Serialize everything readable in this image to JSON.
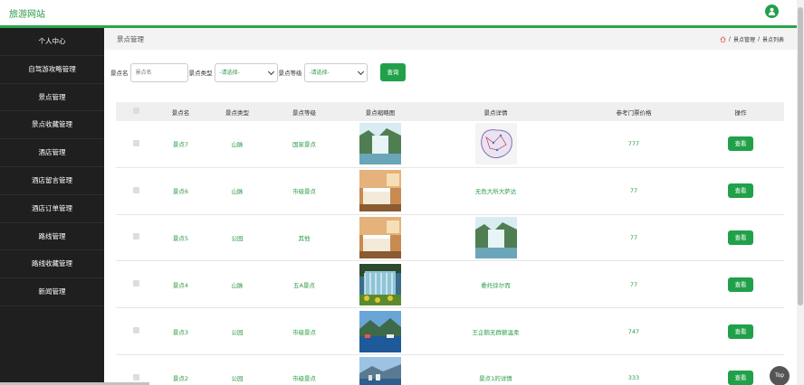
{
  "header": {
    "brand": "旅游网站"
  },
  "sidebar": {
    "items": [
      {
        "label": "个人中心"
      },
      {
        "label": "自驾游攻略管理"
      },
      {
        "label": "景点管理"
      },
      {
        "label": "景点收藏管理"
      },
      {
        "label": "酒店管理"
      },
      {
        "label": "酒店留言管理"
      },
      {
        "label": "酒店订单管理"
      },
      {
        "label": "路线管理"
      },
      {
        "label": "路线收藏管理"
      },
      {
        "label": "新闻管理"
      }
    ]
  },
  "page": {
    "title": "景点管理",
    "breadcrumb": [
      "景点管理",
      "景点列表"
    ],
    "separator": "/"
  },
  "search": {
    "name_label": "景点名",
    "name_placeholder": "景点名",
    "type_label": "景点类型",
    "type_value": "-请选择-",
    "level_label": "景点等级",
    "level_value": "-请选择-",
    "query_button": "查询"
  },
  "table": {
    "headers": [
      "景点名",
      "景点类型",
      "景点等级",
      "景点缩略图",
      "景点详情",
      "参考门票价格",
      "操作"
    ],
    "rows": [
      {
        "name": "景点7",
        "type": "山脉",
        "level": "国家景点",
        "detail": "",
        "price": "777",
        "action": "查看",
        "thumb": "waterfall",
        "detail_image": "map"
      },
      {
        "name": "景点6",
        "type": "山脉",
        "level": "市级景点",
        "detail": "无色大所大萨达",
        "price": "77",
        "action": "查看",
        "thumb": "hotel-room",
        "detail_image": ""
      },
      {
        "name": "景点5",
        "type": "公园",
        "level": "其他",
        "detail": "",
        "price": "77",
        "action": "查看",
        "thumb": "hotel-room",
        "detail_image": "waterfall"
      },
      {
        "name": "景点4",
        "type": "山脉",
        "level": "五A景点",
        "detail": "委托徐尔而",
        "price": "77",
        "action": "查看",
        "thumb": "waterfall-flowers",
        "detail_image": ""
      },
      {
        "name": "景点3",
        "type": "公园",
        "level": "市级景点",
        "detail": "王企鹅无群额温柔",
        "price": "747",
        "action": "查看",
        "thumb": "lake",
        "detail_image": ""
      },
      {
        "name": "景点2",
        "type": "公园",
        "level": "市级景点",
        "detail": "景点1的详情",
        "price": "333",
        "action": "查看",
        "thumb": "lake-city",
        "detail_image": ""
      }
    ]
  },
  "to_top": "Top",
  "colors": {
    "accent": "#21a04a",
    "sidebar": "#1f1f1f"
  }
}
